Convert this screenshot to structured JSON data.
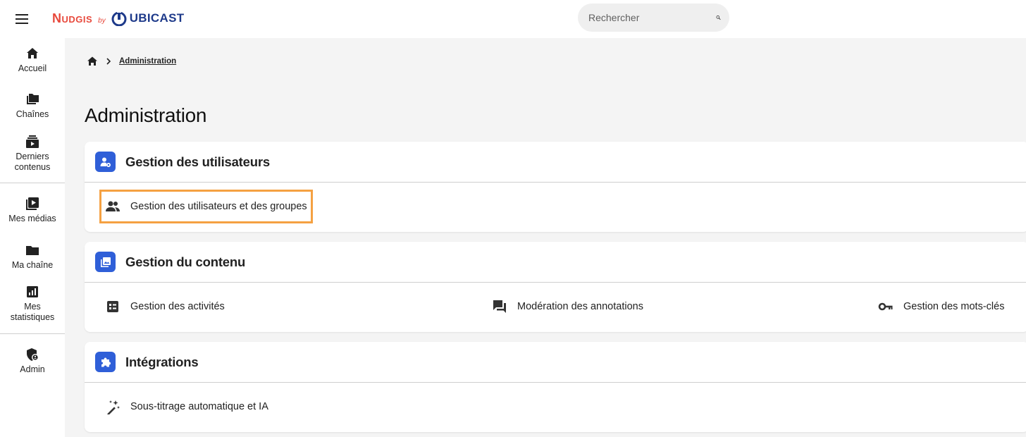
{
  "header": {
    "logo_primary": "Nudgis",
    "logo_by": "by",
    "logo_secondary": "UBICAST",
    "search_placeholder": "Rechercher"
  },
  "sidebar": {
    "items": [
      {
        "label": "Accueil",
        "icon": "home-icon"
      },
      {
        "label": "Chaînes",
        "icon": "channels-icon"
      },
      {
        "label": "Derniers contenus",
        "icon": "latest-content-icon"
      },
      {
        "label": "Mes médias",
        "icon": "my-media-icon"
      },
      {
        "label": "Ma chaîne",
        "icon": "folder-icon"
      },
      {
        "label": "Mes statistiques",
        "icon": "stats-icon"
      },
      {
        "label": "Admin",
        "icon": "admin-shield-icon"
      }
    ]
  },
  "breadcrumb": {
    "current": "Administration"
  },
  "page_title": "Administration",
  "sections": [
    {
      "title": "Gestion des utilisateurs",
      "items": [
        {
          "label": "Gestion des utilisateurs et des groupes",
          "icon": "users-icon"
        }
      ]
    },
    {
      "title": "Gestion du contenu",
      "items": [
        {
          "label": "Gestion des activités",
          "icon": "activities-icon"
        },
        {
          "label": "Modération des annotations",
          "icon": "annotations-icon"
        },
        {
          "label": "Gestion des mots-clés",
          "icon": "key-icon"
        }
      ]
    },
    {
      "title": "Intégrations",
      "items": [
        {
          "label": "Sous-titrage automatique et IA",
          "icon": "magic-wand-icon"
        }
      ]
    }
  ],
  "colors": {
    "accent_blue": "#2f5fd8",
    "brand_red": "#e8493c",
    "brand_navy": "#1e3a8a",
    "highlight_orange": "#f5a142"
  }
}
